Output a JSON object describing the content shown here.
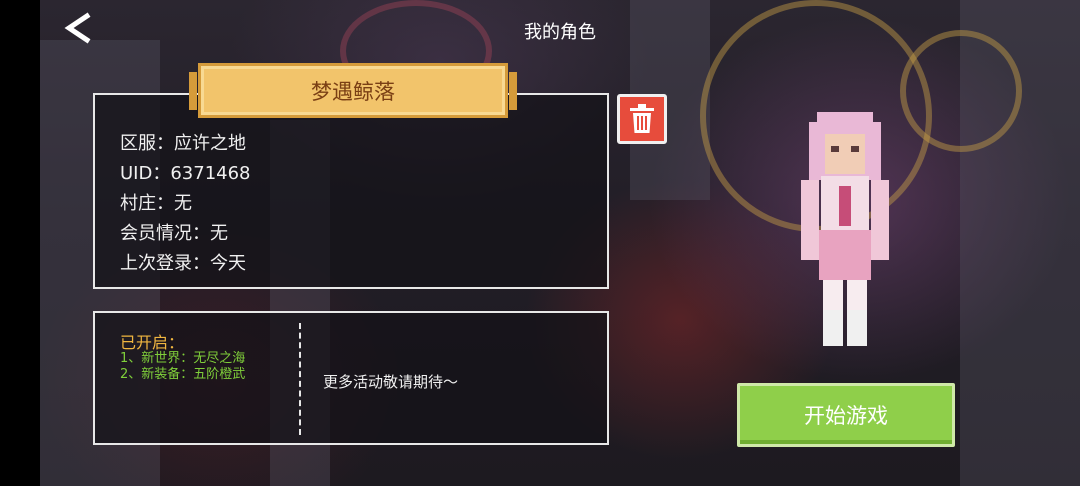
{
  "header": {
    "title": "我的角色",
    "back_icon": "chevron-left-icon"
  },
  "character": {
    "name": "梦遇鲸落",
    "info": [
      "区服：应许之地",
      "UID：6371468",
      "村庄：无",
      "会员情况：无",
      "上次登录：今天"
    ]
  },
  "events": {
    "opened_title": "已开启：",
    "items": [
      "1、新世界：无尽之海",
      "2、新装备：五阶橙武"
    ],
    "more_text": "更多活动敬请期待～"
  },
  "actions": {
    "start_label": "开始游戏",
    "delete_icon": "trash-icon"
  },
  "colors": {
    "name_plate": "#f2c46b",
    "name_text": "#7a3f14",
    "delete_button": "#e74c3c",
    "start_button": "#8fcf4a",
    "opened_title": "#f0b640",
    "event_items": "#7fcf3a"
  }
}
